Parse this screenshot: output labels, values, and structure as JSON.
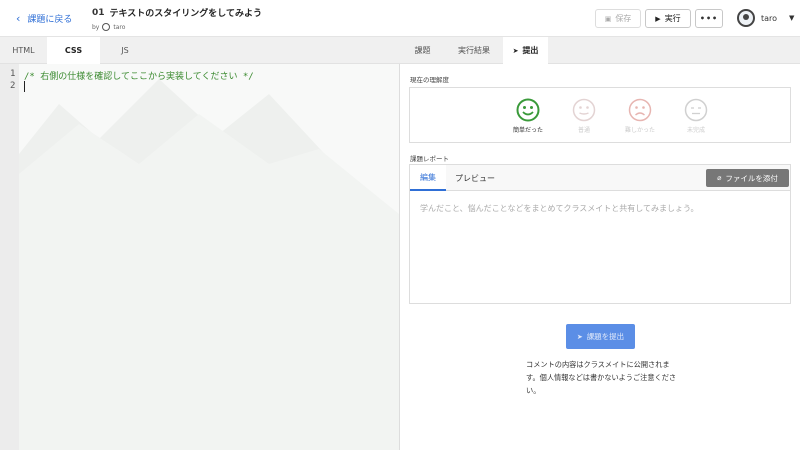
{
  "header": {
    "back_label": "課題に戻る",
    "lesson_number": "01",
    "lesson_title": "テキストのスタイリングをしてみよう",
    "by_label": "by",
    "author": "taro",
    "save_label": "保存",
    "run_label": "実行",
    "more_label": "•••",
    "user_name": "taro"
  },
  "editor": {
    "tabs": [
      {
        "label": "HTML",
        "active": false
      },
      {
        "label": "CSS",
        "active": true
      },
      {
        "label": "JS",
        "active": false
      }
    ],
    "line_numbers": [
      "1",
      "2"
    ],
    "code_lines": [
      "/* 右側の仕様を確認してここから実装してください */",
      ""
    ]
  },
  "right_panel": {
    "tabs": [
      {
        "label": "課題",
        "active": false
      },
      {
        "label": "実行結果",
        "active": false
      },
      {
        "label": "提出",
        "active": true
      }
    ],
    "understanding_label": "現在の理解度",
    "faces": [
      {
        "label": "簡単だった",
        "icon": "smile-icon",
        "color": "#3a9a3a",
        "selected": true
      },
      {
        "label": "普通",
        "icon": "neutral-face-icon",
        "color": "#d7c9c9",
        "selected": false
      },
      {
        "label": "難しかった",
        "icon": "frown-icon",
        "color": "#e7b5b1",
        "selected": false
      },
      {
        "label": "未完成",
        "icon": "blank-face-icon",
        "color": "#d0d0d0",
        "selected": false
      }
    ],
    "report_label": "課題レポート",
    "report_tabs": {
      "edit": "編集",
      "preview": "プレビュー"
    },
    "attach_label": "ファイルを添付",
    "report_placeholder": "学んだこと、悩んだことなどをまとめてクラスメイトと共有してみましょう。",
    "submit_label": "課題を提出",
    "notice": "コメントの内容はクラスメイトに公開されます。個人情報などは書かないようご注意ください。"
  },
  "colors": {
    "accent": "#2f6fd6",
    "submit": "#5b8ee6",
    "code_comment": "#3a8a2f"
  }
}
